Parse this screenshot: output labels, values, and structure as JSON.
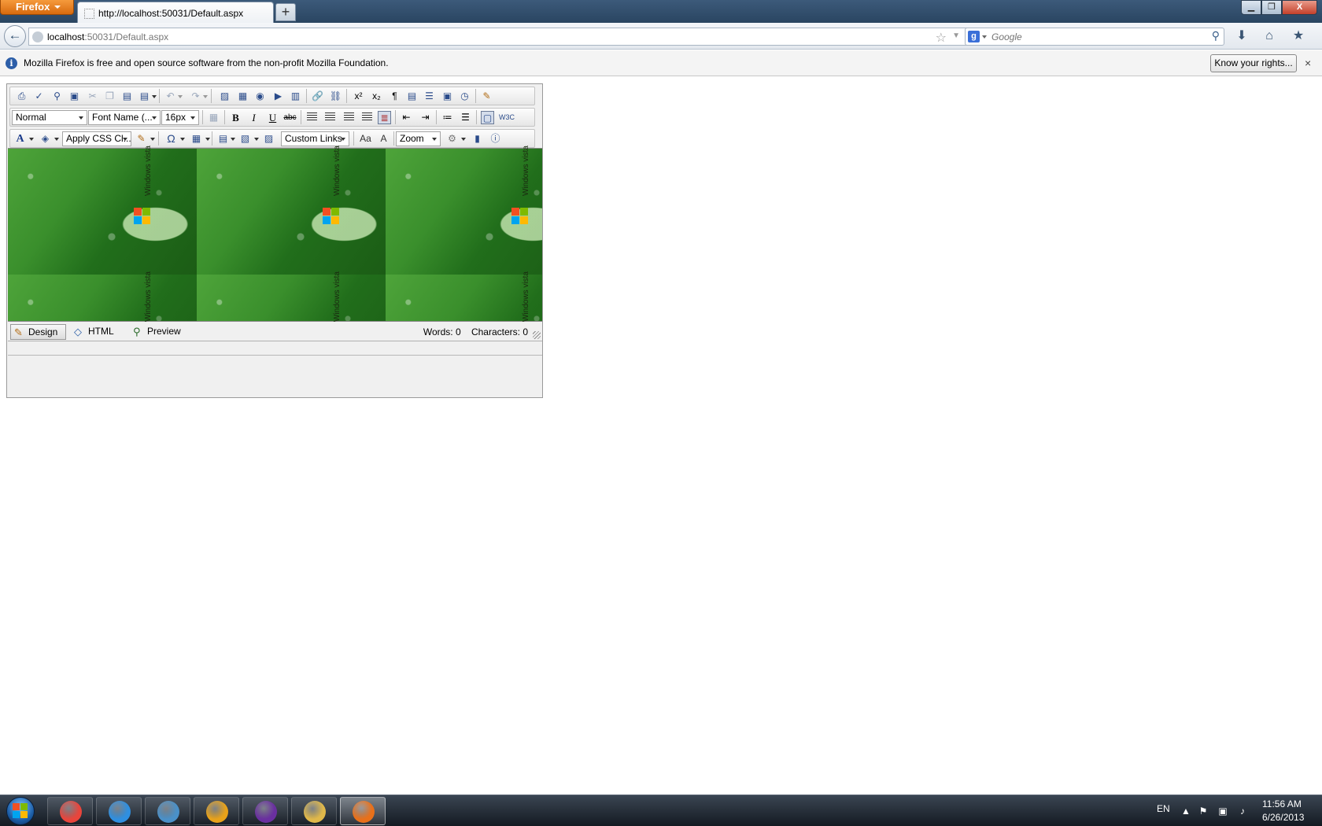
{
  "browser": {
    "menu_label": "Firefox",
    "tab_title": "http://localhost:50031/Default.aspx",
    "new_tab_label": "+",
    "url_host": "localhost",
    "url_path": ":50031/Default.aspx",
    "search_placeholder": "Google",
    "window_controls": {
      "minimize": "▁",
      "maximize": "❐",
      "close": "X"
    }
  },
  "notification": {
    "message": "Mozilla Firefox is free and open source software from the non-profit Mozilla Foundation.",
    "button_label": "Know your rights...",
    "close_label": "×"
  },
  "editor": {
    "format_select": "Normal",
    "font_select": "Font Name (...",
    "size_select": "16px",
    "css_select": "Apply CSS Cl...",
    "links_select": "Custom Links",
    "zoom_select": "Zoom",
    "bold": "B",
    "italic": "I",
    "underline": "U",
    "strike": "abc",
    "watermark_text": "Windows vista",
    "modes": [
      {
        "label": "Design",
        "icon": "pencil-icon"
      },
      {
        "label": "HTML",
        "icon": "code-icon"
      },
      {
        "label": "Preview",
        "icon": "magnifier-icon"
      }
    ],
    "words_label": "Words: 0",
    "chars_label": "Characters: 0"
  },
  "taskbar": {
    "apps": [
      {
        "name": "chrome",
        "color": "#e8453c"
      },
      {
        "name": "internet-explorer",
        "color": "#2f8fe0"
      },
      {
        "name": "lync",
        "color": "#4a90c8"
      },
      {
        "name": "outlook",
        "color": "#e8a21a"
      },
      {
        "name": "visual-studio",
        "color": "#6a2fa0"
      },
      {
        "name": "windows-explorer",
        "color": "#e0b84a"
      },
      {
        "name": "firefox",
        "color": "#e8701a"
      }
    ],
    "language": "EN",
    "time": "11:56 AM",
    "date": "6/26/2013"
  }
}
